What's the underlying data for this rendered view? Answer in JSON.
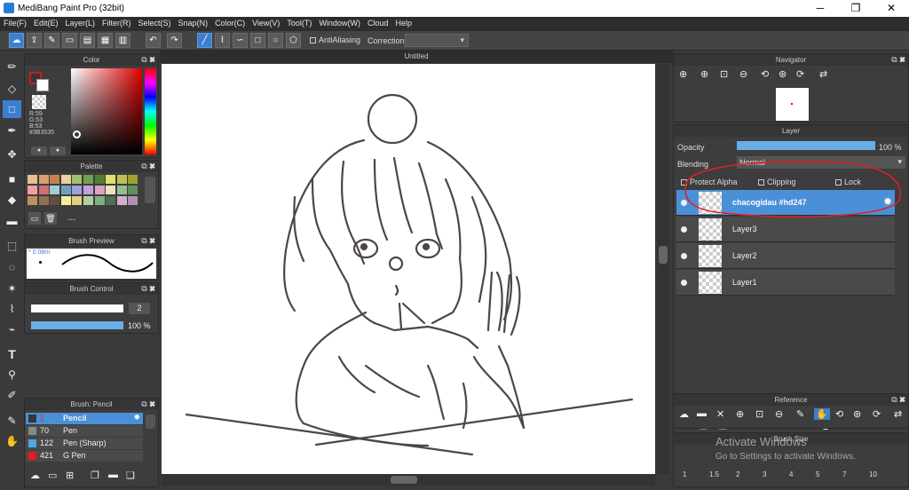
{
  "window": {
    "title": "MediBang Paint Pro (32bit)",
    "minimize": "─",
    "maximize": "❐",
    "close": "✕"
  },
  "menu": [
    "File(F)",
    "Edit(E)",
    "Layer(L)",
    "Filter(R)",
    "Select(S)",
    "Snap(N)",
    "Color(C)",
    "View(V)",
    "Tool(T)",
    "Window(W)",
    "Cloud",
    "Help"
  ],
  "toolbar": {
    "antialiasing": "AntiAliasing",
    "correction": "Correction"
  },
  "canvas": {
    "tab_title": "Untitled"
  },
  "color_panel": {
    "title": "Color",
    "r": "R:59",
    "g": "G:53",
    "b": "B:53",
    "hex": "#3B3535",
    "colors": {
      "primary": "#3b3535",
      "accent": "#3b7fd0"
    }
  },
  "palette_panel": {
    "title": "Palette",
    "dash": "---"
  },
  "brush_preview": {
    "title": "Brush Preview",
    "size": "* 0.08m"
  },
  "brush_control": {
    "title": "Brush Control",
    "size_value": "2",
    "opacity_value": "100 %",
    "opacity_fraction": 1.0
  },
  "brush_panel": {
    "title": "Brush: Pencil",
    "items": [
      {
        "size": "2",
        "name": "Pencil",
        "color": "#3b3535"
      },
      {
        "size": "70",
        "name": "Pen",
        "color": "#888888"
      },
      {
        "size": "122",
        "name": "Pen (Sharp)",
        "color": "#4aa8e8"
      },
      {
        "size": "421",
        "name": "G Pen",
        "color": "#e02020"
      }
    ]
  },
  "navigator": {
    "title": "Navigator"
  },
  "layer_panel": {
    "title": "Layer",
    "opacity_label": "Opacity",
    "opacity_value": "100 %",
    "opacity_fraction": 1.0,
    "blending_label": "Blending",
    "blending_value": "Normal",
    "protect_alpha": "Protect Alpha",
    "clipping": "Clipping",
    "lock": "Lock",
    "layers": [
      "chacogidau #hd247",
      "Layer3",
      "Layer2",
      "Layer1"
    ]
  },
  "reference": {
    "title": "Reference"
  },
  "brush_size": {
    "title": "Brush Size",
    "ticks": [
      "1",
      "1.5",
      "2",
      "3",
      "4",
      "5",
      "7",
      "10"
    ]
  },
  "watermark": {
    "line1": "Activate Windows",
    "line2": "Go to Settings to activate Windows."
  }
}
